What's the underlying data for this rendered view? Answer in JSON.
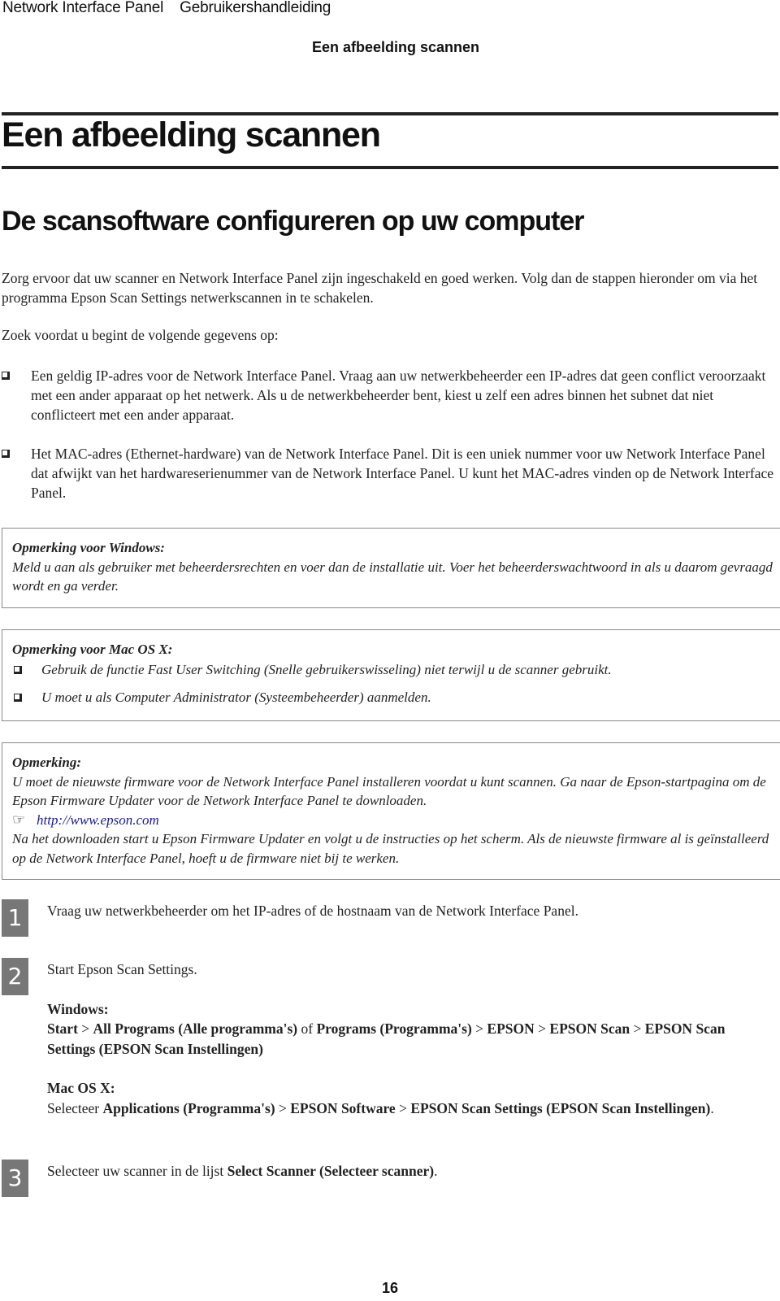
{
  "header": {
    "product": "Network Interface Panel",
    "doc_type": "Gebruikershandleiding",
    "section": "Een afbeelding scannen"
  },
  "chapter_title": "Een afbeelding scannen",
  "section_title": "De scansoftware configureren op uw computer",
  "intro": "Zorg ervoor dat uw scanner en Network Interface Panel zijn ingeschakeld en goed werken. Volg dan de stappen hieronder om via het programma Epson Scan Settings netwerkscannen in te schakelen.",
  "prereq_lead": "Zoek voordat u begint de volgende gegevens op:",
  "prereq_items": [
    "Een geldig IP-adres voor de Network Interface Panel. Vraag aan uw netwerkbeheerder een IP-adres dat geen conflict veroorzaakt met een ander apparaat op het netwerk. Als u de netwerkbeheerder bent, kiest u zelf een adres binnen het subnet dat niet conflicteert met een ander apparaat.",
    "Het MAC-adres (Ethernet-hardware) van de Network Interface Panel. Dit is een uniek nummer voor uw Network Interface Panel dat afwijkt van het hardwareserienummer van de Network Interface Panel. U kunt het MAC-adres vinden op de Network Interface Panel."
  ],
  "notes": {
    "windows": {
      "title": "Opmerking voor Windows:",
      "text": "Meld u aan als gebruiker met beheerdersrechten en voer dan de installatie uit. Voer het beheerderswachtwoord in als u daarom gevraagd wordt en ga verder."
    },
    "mac": {
      "title": "Opmerking voor Mac OS X:",
      "items": [
        "Gebruik de functie Fast User Switching (Snelle gebruikerswisseling) niet terwijl u de scanner gebruikt.",
        "U moet u als Computer Administrator (Systeembeheerder) aanmelden."
      ]
    },
    "general": {
      "title": "Opmerking:",
      "text1": "U moet de nieuwste firmware voor de Network Interface Panel installeren voordat u kunt scannen. Ga naar de Epson-startpagina om de Epson Firmware Updater voor de Network Interface Panel te downloaden.",
      "link_icon": "☞",
      "link": "http://www.epson.com",
      "text2": "Na het downloaden start u Epson Firmware Updater en volgt u de instructies op het scherm. Als de nieuwste firmware al is geïnstalleerd op de Network Interface Panel, hoeft u de firmware niet bij te werken."
    }
  },
  "steps": [
    {
      "num": "1",
      "text": "Vraag uw netwerkbeheerder om het IP-adres of de hostnaam van de Network Interface Panel."
    },
    {
      "num": "2",
      "text": "Start Epson Scan Settings.",
      "windows_label": "Windows:",
      "windows_path": {
        "p1": "Start",
        "s1": " > ",
        "p2": "All Programs (Alle programma's)",
        "s2": " of ",
        "p3": "Programs (Programma's)",
        "s3": " > ",
        "p4": "EPSON",
        "s4": " > ",
        "p5": "EPSON Scan",
        "s5": " > ",
        "p6": "EPSON Scan Settings (EPSON Scan Instellingen)"
      },
      "mac_label": "Mac OS X:",
      "mac_path": {
        "lead": "Selecteer ",
        "p1": "Applications (Programma's)",
        "s1": " > ",
        "p2": "EPSON Software",
        "s2": " > ",
        "p3": "EPSON Scan Settings (EPSON Scan Instellingen)",
        "end": "."
      }
    },
    {
      "num": "3",
      "lead": "Selecteer uw scanner in de lijst ",
      "bold": "Select Scanner (Selecteer scanner)",
      "end": "."
    }
  ],
  "page_number": "16",
  "colors": {
    "step_badge": "#777777",
    "link": "#1a1a9a",
    "note_border": "#888888"
  }
}
